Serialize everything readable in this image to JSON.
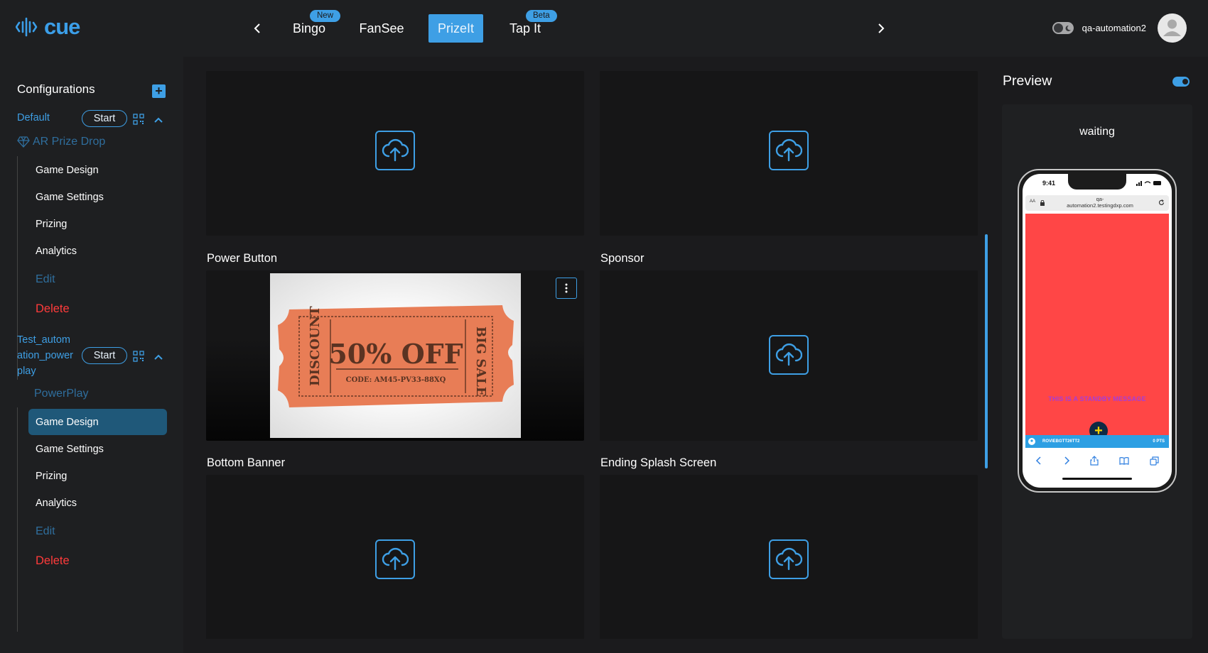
{
  "brand": {
    "name": "cue",
    "color": "#3b9ee8"
  },
  "topnav": {
    "tabs": [
      {
        "label": "Bingo",
        "badge": "New"
      },
      {
        "label": "FanSee",
        "badge": ""
      },
      {
        "label": "PrizeIt",
        "badge": "",
        "active": true
      },
      {
        "label": "Tap It",
        "badge": "Beta"
      }
    ],
    "username": "qa-automation2"
  },
  "sidebar": {
    "title": "Configurations",
    "configs": [
      {
        "name": "Default",
        "start_label": "Start",
        "game_type": "AR Prize Drop",
        "items": [
          "Game Design",
          "Game Settings",
          "Prizing",
          "Analytics"
        ],
        "edit_label": "Edit",
        "delete_label": "Delete"
      },
      {
        "name_lines": [
          "Test_autom",
          "ation_power",
          "play"
        ],
        "start_label": "Start",
        "game_type": "PowerPlay",
        "items": [
          "Game Design",
          "Game Settings",
          "Prizing",
          "Analytics"
        ],
        "active_item": "Game Design",
        "edit_label": "Edit",
        "delete_label": "Delete"
      }
    ]
  },
  "main": {
    "panels": [
      {
        "label": "Power Button",
        "coupon": {
          "headline": "50% OFF",
          "code": "CODE: AM45-PV33-88XQ",
          "left_text": "DISCOUNT",
          "right_text": "BIG SALE"
        }
      },
      {
        "label": "Sponsor"
      },
      {
        "label": "Bottom Banner"
      },
      {
        "label": "Ending Splash Screen"
      }
    ]
  },
  "preview": {
    "title": "Preview",
    "status": "waiting",
    "phone": {
      "time": "9:41",
      "url_line1": "qa-",
      "url_line2": "automation2.testingdxp.com",
      "url_aa": "AA",
      "standby_message": "THIS IS A STANDBY MESSAGE",
      "fab_symbol": "+",
      "strip_left": "ROVIEBGTT26TT2",
      "strip_right": "0 PTS",
      "bg_color": "#ff4646"
    }
  }
}
